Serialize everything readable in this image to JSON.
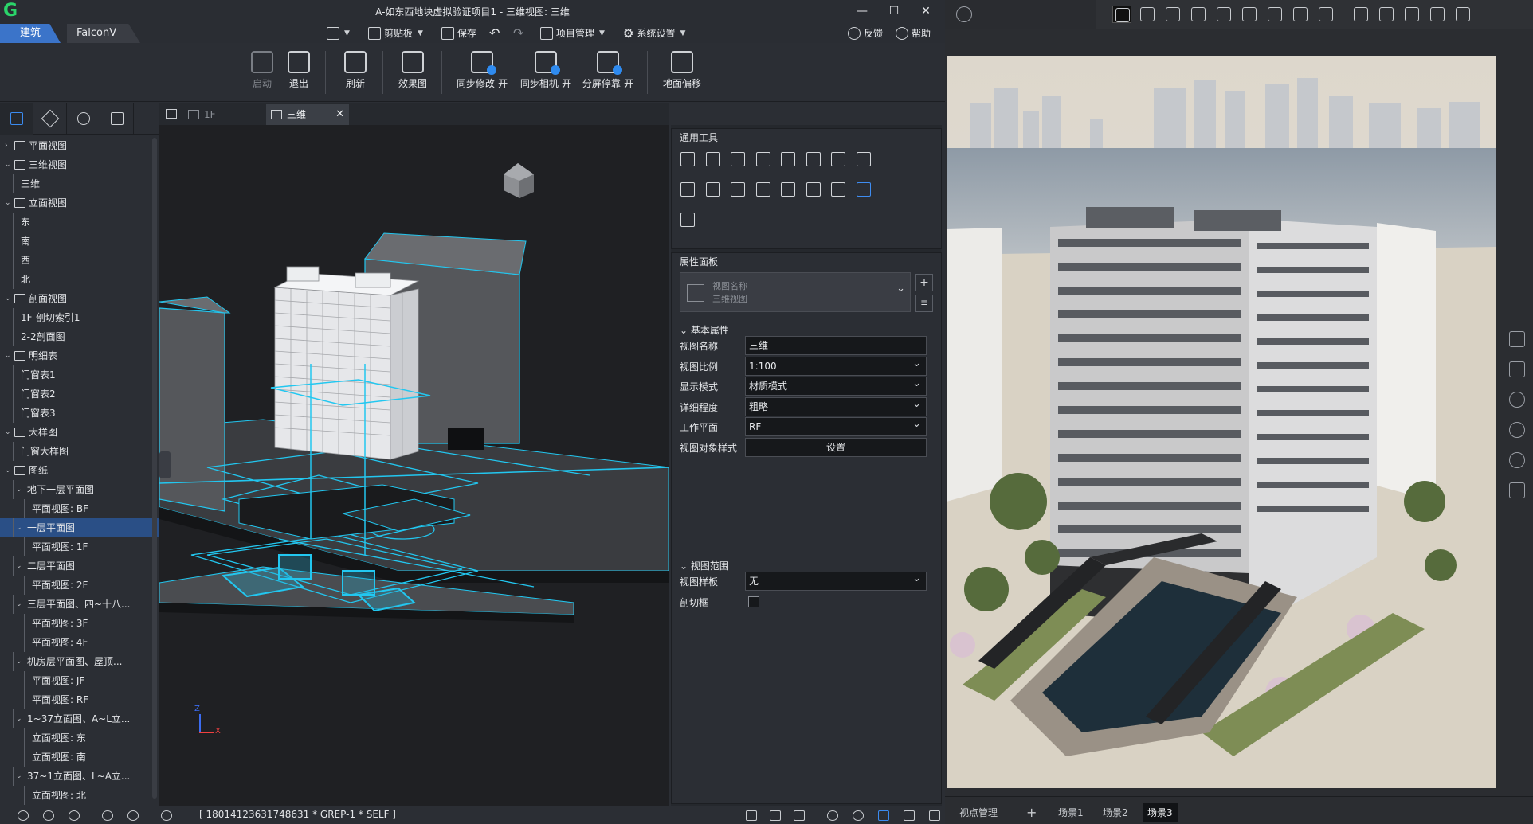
{
  "left_app": {
    "logo": "G",
    "title": "A-如东西地块虚拟验证项目1 - 三维视图: 三维",
    "tabs": [
      "建筑",
      "FalconV"
    ],
    "quick_access": {
      "clipboard": "剪贴板",
      "save": "保存",
      "project_manage": "项目管理",
      "system_settings": "系统设置",
      "feedback": "反馈",
      "help": "帮助"
    },
    "ribbon": [
      {
        "label": "启动",
        "disabled": true
      },
      {
        "label": "退出",
        "disabled": false
      },
      {
        "label": "刷新",
        "disabled": false
      },
      {
        "label": "效果图",
        "disabled": false
      },
      {
        "label": "同步修改-开",
        "disabled": false
      },
      {
        "label": "同步相机-开",
        "disabled": false
      },
      {
        "label": "分屏停靠-开",
        "disabled": false
      },
      {
        "label": "地面偏移",
        "disabled": false
      }
    ],
    "view_tabs": [
      "1F",
      "三维"
    ],
    "tree": [
      {
        "label": "平面视图",
        "level": 0,
        "arrow": "right"
      },
      {
        "label": "三维视图",
        "level": 0,
        "arrow": "down"
      },
      {
        "label": "三维",
        "level": 1
      },
      {
        "label": "立面视图",
        "level": 0,
        "arrow": "down"
      },
      {
        "label": "东",
        "level": 1
      },
      {
        "label": "南",
        "level": 1
      },
      {
        "label": "西",
        "level": 1
      },
      {
        "label": "北",
        "level": 1
      },
      {
        "label": "剖面视图",
        "level": 0,
        "arrow": "down"
      },
      {
        "label": "1F-剖切索引1",
        "level": 1
      },
      {
        "label": "2-2剖面图",
        "level": 1
      },
      {
        "label": "明细表",
        "level": 0,
        "arrow": "down"
      },
      {
        "label": "门窗表1",
        "level": 1
      },
      {
        "label": "门窗表2",
        "level": 1
      },
      {
        "label": "门窗表3",
        "level": 1
      },
      {
        "label": "大样图",
        "level": 0,
        "arrow": "down"
      },
      {
        "label": "门窗大样图",
        "level": 1
      },
      {
        "label": "图纸",
        "level": 0,
        "arrow": "down"
      },
      {
        "label": "地下一层平面图",
        "level": 1,
        "arrow": "down"
      },
      {
        "label": "平面视图: BF",
        "level": 2
      },
      {
        "label": "一层平面图",
        "level": 1,
        "arrow": "down",
        "selected": true
      },
      {
        "label": "平面视图: 1F",
        "level": 2
      },
      {
        "label": "二层平面图",
        "level": 1,
        "arrow": "down"
      },
      {
        "label": "平面视图: 2F",
        "level": 2
      },
      {
        "label": "三层平面图、四~十八...",
        "level": 1,
        "arrow": "down"
      },
      {
        "label": "平面视图: 3F",
        "level": 2
      },
      {
        "label": "平面视图: 4F",
        "level": 2
      },
      {
        "label": "机房层平面图、屋顶...",
        "level": 1,
        "arrow": "down"
      },
      {
        "label": "平面视图: JF",
        "level": 2
      },
      {
        "label": "平面视图: RF",
        "level": 2
      },
      {
        "label": "1~37立面图、A~L立...",
        "level": 1,
        "arrow": "down"
      },
      {
        "label": "立面视图: 东",
        "level": 2
      },
      {
        "label": "立面视图: 南",
        "level": 2
      },
      {
        "label": "37~1立面图、L~A立...",
        "level": 1,
        "arrow": "down"
      },
      {
        "label": "立面视图: 北",
        "level": 2
      }
    ],
    "axis": {
      "z": "Z",
      "x": "X"
    },
    "tools_panel": {
      "title": "通用工具",
      "tools": [
        "move-icon",
        "copy-icon",
        "rotate-icon",
        "align-icon",
        "offset-icon",
        "split-icon",
        "extend-icon",
        "trim-icon",
        "trim-single-icon",
        "split-element-icon",
        "scale-icon",
        "array-icon",
        "mirror-icon",
        "mirror-draw-icon",
        "delete-icon",
        "wall-edit-icon",
        "measure-icon"
      ]
    },
    "props_panel": {
      "title": "属性面板",
      "type_name": "视图名称",
      "type_value": "三维视图",
      "basic_section": "基本属性",
      "rows": [
        {
          "label": "视图名称",
          "value": "三维",
          "kind": "text"
        },
        {
          "label": "视图比例",
          "value": "1:100",
          "kind": "select"
        },
        {
          "label": "显示模式",
          "value": "材质模式",
          "kind": "select"
        },
        {
          "label": "详细程度",
          "value": "粗略",
          "kind": "select"
        },
        {
          "label": "工作平面",
          "value": "RF",
          "kind": "select"
        },
        {
          "label": "视图对象样式",
          "value": "设置",
          "kind": "button"
        }
      ],
      "range_section": "视图范围",
      "range_rows": [
        {
          "label": "视图样板",
          "value": "无",
          "kind": "select"
        },
        {
          "label": "剖切框",
          "value": "",
          "kind": "check"
        }
      ]
    },
    "status_text": "[ 18014123631748631 * GREP-1 * SELF ]"
  },
  "right_app": {
    "bottom": {
      "viewpoint": "视点管理",
      "add": "+",
      "scenes": [
        "场景1",
        "场景2",
        "场景3"
      ],
      "active_scene": 2
    }
  },
  "colors": {
    "accent_blue": "#3b74c9",
    "wire_cyan": "#22c7f0",
    "logo_green": "#2bd46a",
    "selected_row": "#2a4f86"
  }
}
